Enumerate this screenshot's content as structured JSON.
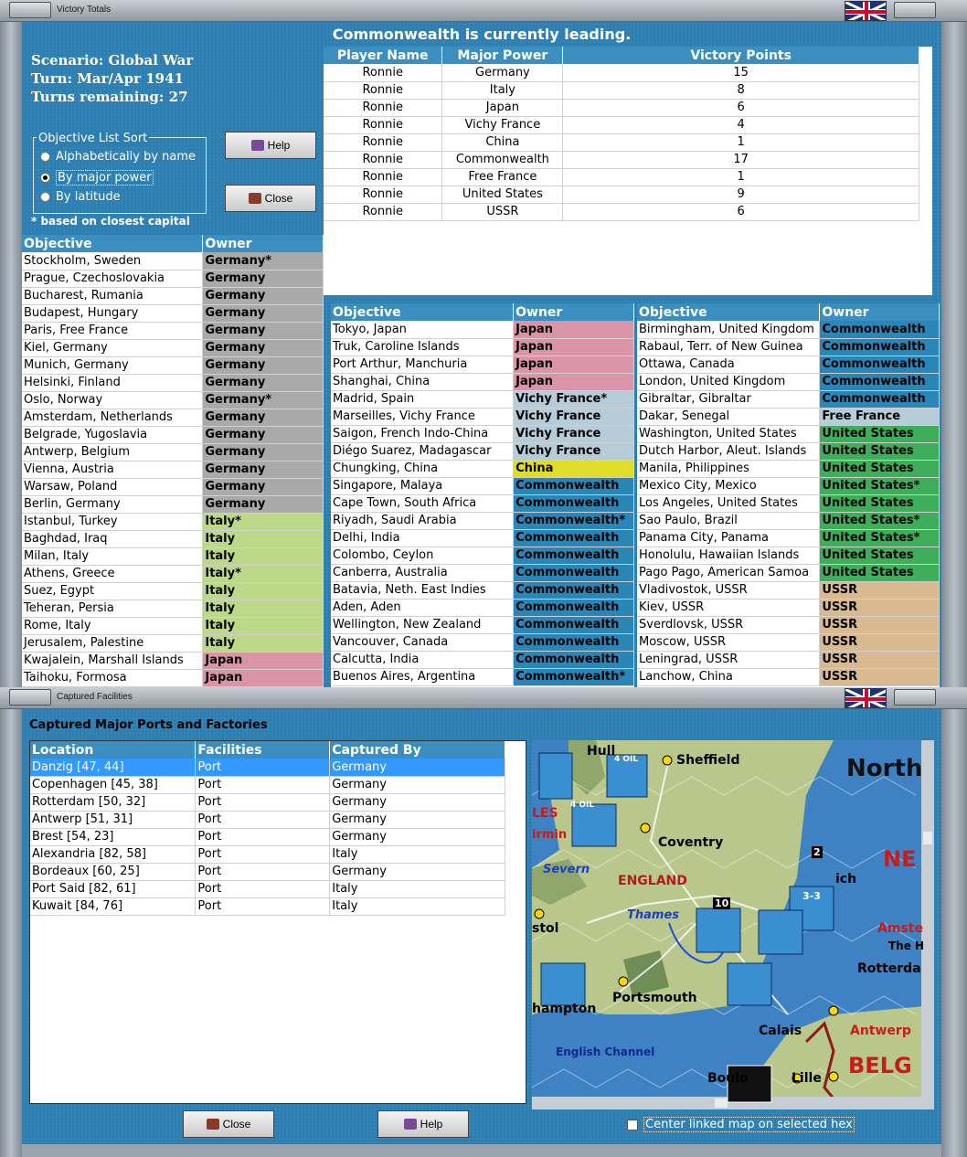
{
  "window1": {
    "title": "Victory Totals",
    "leading_text": "Commonwealth is currently leading.",
    "scenario": "Scenario: Global War",
    "turn": "Turn: Mar/Apr 1941",
    "turns_remaining": "Turns remaining: 27",
    "sort_legend": "Objective List Sort",
    "sort_options": [
      "Alphabetically by name",
      "By major power",
      "By latitude"
    ],
    "sort_selected": 1,
    "note": "* based on closest capital",
    "help_label": "Help",
    "close_label": "Close",
    "vp_headers": [
      "Player Name",
      "Major Power",
      "Victory Points"
    ],
    "vp_rows": [
      [
        "Ronnie",
        "Germany",
        "15"
      ],
      [
        "Ronnie",
        "Italy",
        "8"
      ],
      [
        "Ronnie",
        "Japan",
        "6"
      ],
      [
        "Ronnie",
        "Vichy France",
        "4"
      ],
      [
        "Ronnie",
        "China",
        "1"
      ],
      [
        "Ronnie",
        "Commonwealth",
        "17"
      ],
      [
        "Ronnie",
        "Free France",
        "1"
      ],
      [
        "Ronnie",
        "United States",
        "9"
      ],
      [
        "Ronnie",
        "USSR",
        "6"
      ]
    ],
    "obj_headers": [
      "Objective",
      "Owner"
    ],
    "obj_col1": [
      [
        "Stockholm, Sweden",
        "Germany*",
        "germany"
      ],
      [
        "Prague, Czechoslovakia",
        "Germany",
        "germany"
      ],
      [
        "Bucharest, Rumania",
        "Germany",
        "germany"
      ],
      [
        "Budapest, Hungary",
        "Germany",
        "germany"
      ],
      [
        "Paris, Free France",
        "Germany",
        "germany"
      ],
      [
        "Kiel, Germany",
        "Germany",
        "germany"
      ],
      [
        "Munich, Germany",
        "Germany",
        "germany"
      ],
      [
        "Helsinki, Finland",
        "Germany",
        "germany"
      ],
      [
        "Oslo, Norway",
        "Germany*",
        "germany"
      ],
      [
        "Amsterdam, Netherlands",
        "Germany",
        "germany"
      ],
      [
        "Belgrade, Yugoslavia",
        "Germany",
        "germany"
      ],
      [
        "Antwerp, Belgium",
        "Germany",
        "germany"
      ],
      [
        "Vienna, Austria",
        "Germany",
        "germany"
      ],
      [
        "Warsaw, Poland",
        "Germany",
        "germany"
      ],
      [
        "Berlin, Germany",
        "Germany",
        "germany"
      ],
      [
        "Istanbul, Turkey",
        "Italy*",
        "italy"
      ],
      [
        "Baghdad, Iraq",
        "Italy",
        "italy"
      ],
      [
        "Milan, Italy",
        "Italy",
        "italy"
      ],
      [
        "Athens, Greece",
        "Italy*",
        "italy"
      ],
      [
        "Suez, Egypt",
        "Italy",
        "italy"
      ],
      [
        "Teheran, Persia",
        "Italy",
        "italy"
      ],
      [
        "Rome, Italy",
        "Italy",
        "italy"
      ],
      [
        "Jerusalem, Palestine",
        "Italy",
        "italy"
      ],
      [
        "Kwajalein, Marshall Islands",
        "Japan",
        "japan"
      ],
      [
        "Taihoku, Formosa",
        "Japan",
        "japan"
      ]
    ],
    "obj_col2": [
      [
        "Tokyo, Japan",
        "Japan",
        "japan"
      ],
      [
        "Truk, Caroline Islands",
        "Japan",
        "japan"
      ],
      [
        "Port Arthur, Manchuria",
        "Japan",
        "japan"
      ],
      [
        "Shanghai, China",
        "Japan",
        "japan"
      ],
      [
        "Madrid, Spain",
        "Vichy France*",
        "vichy"
      ],
      [
        "Marseilles, Vichy France",
        "Vichy France",
        "vichy"
      ],
      [
        "Saigon, French Indo-China",
        "Vichy France",
        "vichy"
      ],
      [
        "Diégo Suarez, Madagascar",
        "Vichy France",
        "vichy"
      ],
      [
        "Chungking, China",
        "China",
        "china"
      ],
      [
        "Singapore, Malaya",
        "Commonwealth",
        "cw"
      ],
      [
        "Cape Town, South Africa",
        "Commonwealth",
        "cw"
      ],
      [
        "Riyadh, Saudi Arabia",
        "Commonwealth*",
        "cw"
      ],
      [
        "Delhi, India",
        "Commonwealth",
        "cw"
      ],
      [
        "Colombo, Ceylon",
        "Commonwealth",
        "cw"
      ],
      [
        "Canberra, Australia",
        "Commonwealth",
        "cw"
      ],
      [
        "Batavia, Neth. East Indies",
        "Commonwealth",
        "cw"
      ],
      [
        "Aden, Aden",
        "Commonwealth",
        "cw"
      ],
      [
        "Wellington, New Zealand",
        "Commonwealth",
        "cw"
      ],
      [
        "Vancouver, Canada",
        "Commonwealth",
        "cw"
      ],
      [
        "Calcutta, India",
        "Commonwealth",
        "cw"
      ],
      [
        "Buenos Aires, Argentina",
        "Commonwealth*",
        "cw"
      ]
    ],
    "obj_col3": [
      [
        "Birmingham, United Kingdom",
        "Commonwealth",
        "cw"
      ],
      [
        "Rabaul, Terr. of New Guinea",
        "Commonwealth",
        "cw"
      ],
      [
        "Ottawa, Canada",
        "Commonwealth",
        "cw"
      ],
      [
        "London, United Kingdom",
        "Commonwealth",
        "cw"
      ],
      [
        "Gibraltar, Gibraltar",
        "Commonwealth",
        "cw"
      ],
      [
        "Dakar, Senegal",
        "Free France",
        "ff"
      ],
      [
        "Washington, United States",
        "United States",
        "us"
      ],
      [
        "Dutch Harbor, Aleut. Islands",
        "United States",
        "us"
      ],
      [
        "Manila, Philippines",
        "United States",
        "us"
      ],
      [
        "Mexico City, Mexico",
        "United States*",
        "us"
      ],
      [
        "Los Angeles, United States",
        "United States",
        "us"
      ],
      [
        "Sao Paulo, Brazil",
        "United States*",
        "us"
      ],
      [
        "Panama City, Panama",
        "United States*",
        "us"
      ],
      [
        "Honolulu, Hawaiian Islands",
        "United States",
        "us"
      ],
      [
        "Pago Pago, American Samoa",
        "United States",
        "us"
      ],
      [
        "Vladivostok, USSR",
        "USSR",
        "ussr"
      ],
      [
        "Kiev, USSR",
        "USSR",
        "ussr"
      ],
      [
        "Sverdlovsk, USSR",
        "USSR",
        "ussr"
      ],
      [
        "Moscow, USSR",
        "USSR",
        "ussr"
      ],
      [
        "Leningrad, USSR",
        "USSR",
        "ussr"
      ],
      [
        "Lanchow, China",
        "USSR",
        "ussr"
      ]
    ]
  },
  "window2": {
    "title": "Captured Facilities",
    "heading": "Captured Major Ports and Factories",
    "headers": [
      "Location",
      "Facilities",
      "Captured By"
    ],
    "rows": [
      [
        "Danzig  [47, 44]",
        "Port",
        "Germany"
      ],
      [
        "Copenhagen  [45, 38]",
        "Port",
        "Germany"
      ],
      [
        "Rotterdam  [50, 32]",
        "Port",
        "Germany"
      ],
      [
        "Antwerp  [51, 31]",
        "Port",
        "Germany"
      ],
      [
        "Brest  [54, 23]",
        "Port",
        "Germany"
      ],
      [
        "Alexandria  [82, 58]",
        "Port",
        "Italy"
      ],
      [
        "Bordeaux  [60, 25]",
        "Port",
        "Germany"
      ],
      [
        "Port Said  [82, 61]",
        "Port",
        "Italy"
      ],
      [
        "Kuwait  [84, 76]",
        "Port",
        "Italy"
      ]
    ],
    "selected_row": 0,
    "close_label": "Close",
    "help_label": "Help",
    "center_label": "Center linked map on selected hex",
    "map_labels": {
      "sheffield": "Sheffield",
      "coventry": "Coventry",
      "england": "ENGLAND",
      "severn": "Severn",
      "thames": "Thames",
      "portsmouth": "Portsmouth",
      "english_channel": "English Channel",
      "calais": "Calais",
      "lille": "Lille",
      "antwerp": "Antwerp",
      "rotterdam": "Rotterda",
      "north": "North",
      "ne": "NE",
      "belg": "BELG",
      "amste": "Amste",
      "the_h": "The H",
      "hull": "Hull",
      "les": "LES",
      "birmi": "irmin",
      "stol": "stol",
      "hampton": "hampton",
      "boulo": "Boulo",
      "ich": "ich",
      "oil1": "4 OIL",
      "oil2": "4 OIL",
      "unit_33": "3-3",
      "n10": "10",
      "n2": "2"
    }
  }
}
